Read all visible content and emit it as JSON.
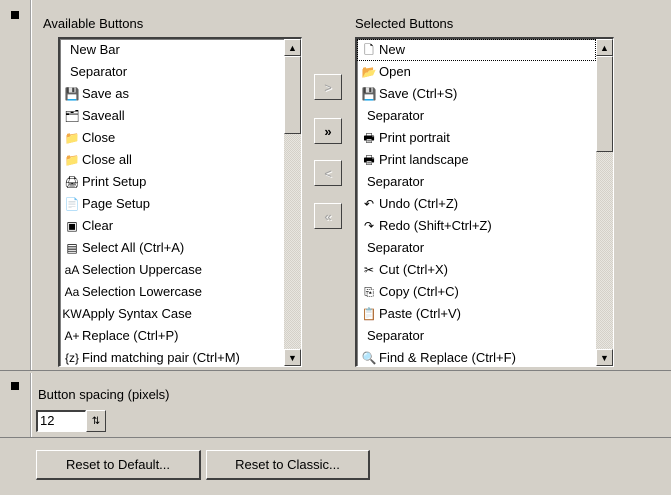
{
  "available": {
    "label": "Available Buttons",
    "items": [
      {
        "label": "New Bar",
        "icon": ""
      },
      {
        "label": "Separator",
        "icon": ""
      },
      {
        "label": "Save as",
        "icon": "save-as-icon",
        "glyph": "💾"
      },
      {
        "label": "Saveall",
        "icon": "save-all-icon",
        "glyph": "🗂"
      },
      {
        "label": "Close",
        "icon": "close-folder-icon",
        "glyph": "📁"
      },
      {
        "label": "Close all",
        "icon": "close-all-icon",
        "glyph": "📁"
      },
      {
        "label": "Print Setup",
        "icon": "print-setup-icon",
        "glyph": "🖨"
      },
      {
        "label": "Page Setup",
        "icon": "page-setup-icon",
        "glyph": "📄"
      },
      {
        "label": "Clear",
        "icon": "clear-icon",
        "glyph": "▣"
      },
      {
        "label": "Select All (Ctrl+A)",
        "icon": "select-all-icon",
        "glyph": "▤"
      },
      {
        "label": "Selection Uppercase",
        "icon": "uppercase-icon",
        "glyph": "aA"
      },
      {
        "label": "Selection Lowercase",
        "icon": "lowercase-icon",
        "glyph": "Aa"
      },
      {
        "label": "Apply Syntax Case",
        "icon": "syntax-case-icon",
        "glyph": "KW"
      },
      {
        "label": "Replace (Ctrl+P)",
        "icon": "replace-icon",
        "glyph": "A+"
      },
      {
        "label": "Find matching pair (Ctrl+M)",
        "icon": "matching-pair-icon",
        "glyph": "{z}"
      }
    ]
  },
  "selected": {
    "label": "Selected Buttons",
    "items": [
      {
        "label": "New",
        "icon": "new-document-icon",
        "glyph": "🗋"
      },
      {
        "label": "Open",
        "icon": "open-folder-icon",
        "glyph": "📂"
      },
      {
        "label": "Save (Ctrl+S)",
        "icon": "save-icon",
        "glyph": "💾"
      },
      {
        "label": "Separator",
        "icon": ""
      },
      {
        "label": "Print portrait",
        "icon": "print-portrait-icon",
        "glyph": "🖶"
      },
      {
        "label": "Print landscape",
        "icon": "print-landscape-icon",
        "glyph": "🖶"
      },
      {
        "label": "Separator",
        "icon": ""
      },
      {
        "label": "Undo (Ctrl+Z)",
        "icon": "undo-icon",
        "glyph": "↶"
      },
      {
        "label": "Redo (Shift+Ctrl+Z)",
        "icon": "redo-icon",
        "glyph": "↷"
      },
      {
        "label": "Separator",
        "icon": ""
      },
      {
        "label": "Cut (Ctrl+X)",
        "icon": "cut-icon",
        "glyph": "✂"
      },
      {
        "label": "Copy (Ctrl+C)",
        "icon": "copy-icon",
        "glyph": "⎘"
      },
      {
        "label": "Paste (Ctrl+V)",
        "icon": "paste-icon",
        "glyph": "📋"
      },
      {
        "label": "Separator",
        "icon": ""
      },
      {
        "label": "Find & Replace (Ctrl+F)",
        "icon": "find-replace-icon",
        "glyph": "🔍"
      }
    ]
  },
  "move_buttons": {
    "add": ">",
    "add_all": "»",
    "remove": "<",
    "remove_all": "«"
  },
  "spacing": {
    "label": "Button spacing (pixels)",
    "value": "12"
  },
  "actions": {
    "reset_default": "Reset to Default...",
    "reset_classic": "Reset to Classic..."
  }
}
